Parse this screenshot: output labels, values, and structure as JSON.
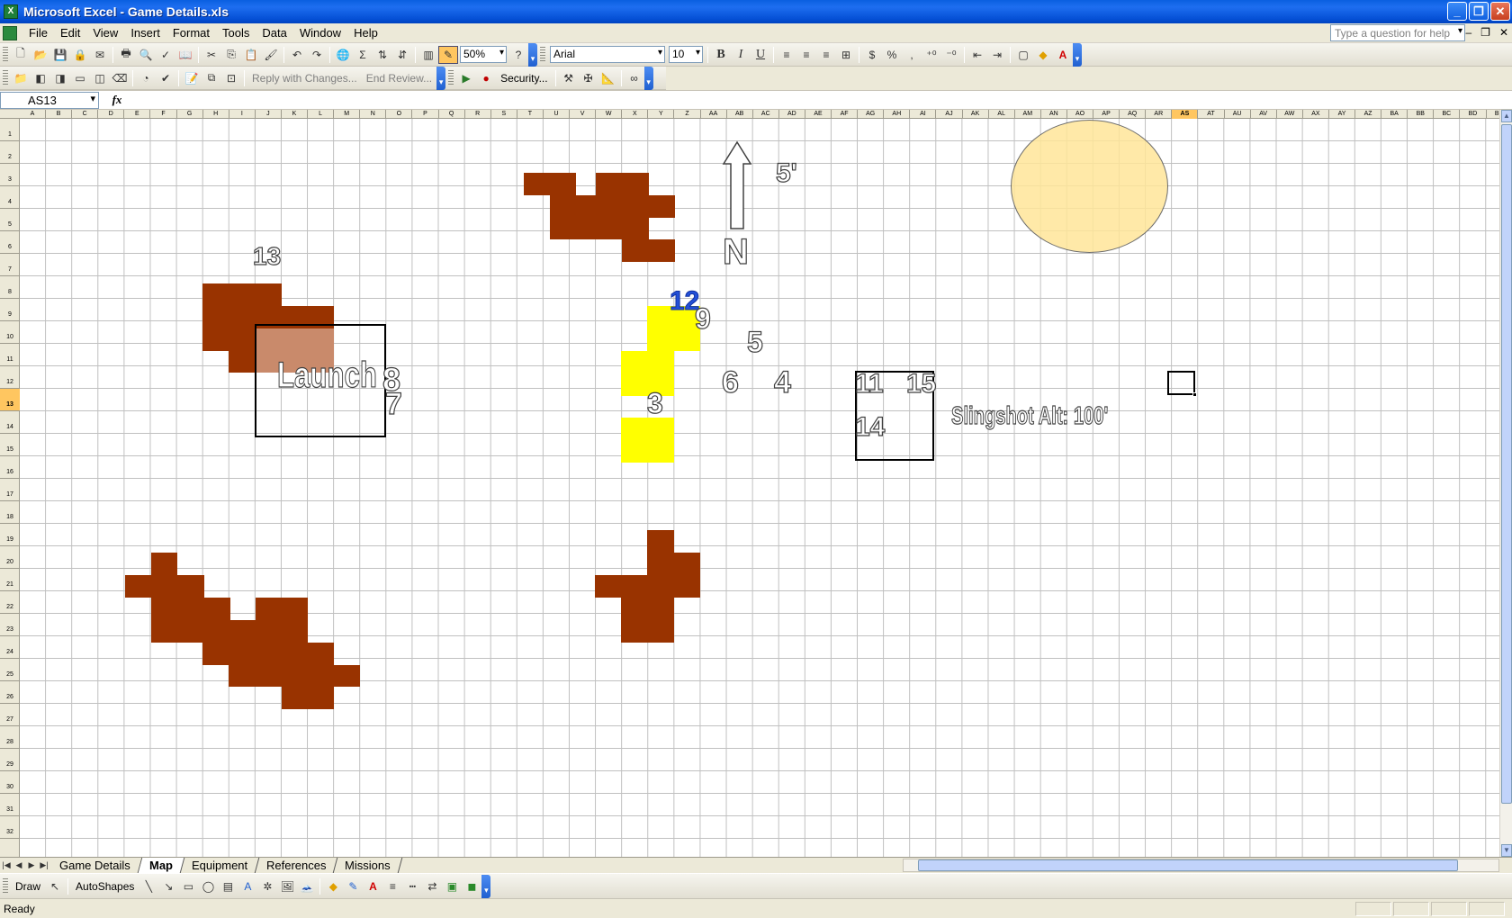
{
  "window": {
    "title": "Microsoft Excel - Game Details.xls",
    "app_icon": "X"
  },
  "menu": {
    "items": [
      "File",
      "Edit",
      "View",
      "Insert",
      "Format",
      "Tools",
      "Data",
      "Window",
      "Help"
    ],
    "help_placeholder": "Type a question for help"
  },
  "toolbar": {
    "zoom": "50%",
    "font_name": "Arial",
    "font_size": "10",
    "bold": "B",
    "italic": "I",
    "underline": "U",
    "percent": "%",
    "comma": ",",
    "sigma": "Σ",
    "reply_with_changes": "Reply with Changes...",
    "end_review": "End Review...",
    "security": "Security..."
  },
  "formula_bar": {
    "name_box": "AS13",
    "fx": "fx",
    "value": ""
  },
  "sheet": {
    "columns": [
      "A",
      "B",
      "C",
      "D",
      "E",
      "F",
      "G",
      "H",
      "I",
      "J",
      "K",
      "L",
      "M",
      "N",
      "O",
      "P",
      "Q",
      "R",
      "S",
      "T",
      "U",
      "V",
      "W",
      "X",
      "Y",
      "Z",
      "AA",
      "AB",
      "AC",
      "AD",
      "AE",
      "AF",
      "AG",
      "AH",
      "AI",
      "AJ",
      "AK",
      "AL",
      "AM",
      "AN",
      "AO",
      "AP",
      "AQ",
      "AR",
      "AS",
      "AT",
      "AU",
      "AV",
      "AW",
      "AX",
      "AY",
      "AZ",
      "BA",
      "BB",
      "BC",
      "BD",
      "BE"
    ],
    "selected_column": "AS",
    "rows": [
      "1",
      "2",
      "3",
      "4",
      "5",
      "6",
      "7",
      "8",
      "9",
      "10",
      "11",
      "12",
      "13",
      "14",
      "15",
      "16",
      "17",
      "18",
      "19",
      "20",
      "21",
      "22",
      "23",
      "24",
      "25",
      "26",
      "27",
      "28",
      "29",
      "30",
      "31",
      "32"
    ],
    "selected_row": "13",
    "colors": {
      "terrain": "#993300",
      "path": "#FFFF00",
      "sun": "#FFE699",
      "launch_fill": "#C98A6B"
    },
    "labels": {
      "north": "N",
      "scale": "5'",
      "launch": "Launch",
      "slingshot": "Slingshot Alt: 100'",
      "n13": "13",
      "n12": "12",
      "n9": "9",
      "n5": "5",
      "n8": "8",
      "n7": "7",
      "n6": "6",
      "n4": "4",
      "n3": "3",
      "n11": "11",
      "n15": "15",
      "n14": "14"
    }
  },
  "sheet_tabs": [
    "Game Details",
    "Map",
    "Equipment",
    "References",
    "Missions"
  ],
  "active_tab": "Map",
  "drawing": {
    "draw": "Draw",
    "autoshapes": "AutoShapes"
  },
  "status": {
    "text": "Ready"
  }
}
